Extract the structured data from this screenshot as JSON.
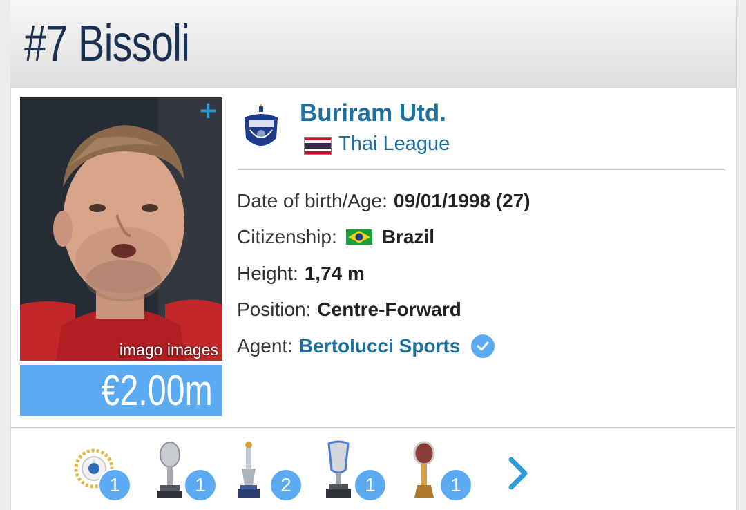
{
  "player": {
    "title": "#7 Bissoli",
    "photo_credit": "imago images",
    "market_value": "€2.00m"
  },
  "club": {
    "name": "Buriram Utd.",
    "league": "Thai League"
  },
  "info": {
    "dob_label": "Date of birth/Age:",
    "dob_value": "09/01/1998 (27)",
    "citizenship_label": "Citizenship:",
    "citizenship_value": "Brazil",
    "height_label": "Height:",
    "height_value": "1,74 m",
    "position_label": "Position:",
    "position_value": "Centre-Forward",
    "agent_label": "Agent:",
    "agent_value": "Bertolucci Sports"
  },
  "trophies": [
    {
      "icon": "champion-badge-icon",
      "count": "1"
    },
    {
      "icon": "silver-trophy-icon",
      "count": "1"
    },
    {
      "icon": "tall-cup-icon",
      "count": "2"
    },
    {
      "icon": "super-cup-icon",
      "count": "1"
    },
    {
      "icon": "gold-trophy-icon",
      "count": "1"
    }
  ],
  "colors": {
    "title": "#1a3151",
    "link": "#1d6f9e",
    "accent": "#5cabf2",
    "plus": "#2d9bd8"
  }
}
